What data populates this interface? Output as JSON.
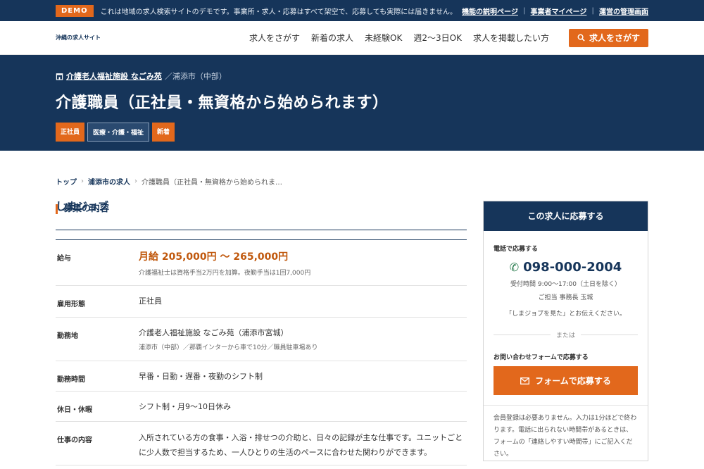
{
  "topbar": {
    "badge": "DEMO",
    "notice": "これは地域の求人検索サイトのデモです。事業所・求人・応募はすべて架空で、応募しても実際には届きません。",
    "links": [
      "機能の説明ページ",
      "事業者マイページ",
      "運営の管理画面"
    ]
  },
  "header": {
    "logo_sub": "沖縄の求人サイト",
    "logo_main": "しまジョブ",
    "nav": [
      "求人をさがす",
      "新着の求人",
      "未経験OK",
      "週2〜3日OK",
      "求人を掲載したい方"
    ],
    "search_button": "求人をさがす"
  },
  "hero": {
    "facility": "介護老人福祉施設 なごみ苑",
    "location": "／浦添市（中部）",
    "title": "介護職員（正社員・無資格から始められます）",
    "tags": [
      "正社員",
      "医療・介護・福祉",
      "新着"
    ]
  },
  "breadcrumb": [
    "トップ",
    "浦添市の求人",
    "介護職員（正社員・無資格から始められま…"
  ],
  "main": {
    "section_title": "募集の内容",
    "rows": [
      {
        "label": "給与",
        "value": "月給 205,000円 〜 265,000円",
        "sub": "介護福祉士は資格手当2万円を加算。夜勤手当は1回7,000円"
      },
      {
        "label": "雇用形態",
        "value": "正社員"
      },
      {
        "label": "勤務地",
        "value": "介護老人福祉施設 なごみ苑（浦添市宮城）",
        "sub": "浦添市（中部）／那覇インターから車で10分／職員駐車場あり"
      },
      {
        "label": "勤務時間",
        "value": "早番・日勤・遅番・夜勤のシフト制"
      },
      {
        "label": "休日・休暇",
        "value": "シフト制・月9〜10日休み"
      },
      {
        "label": "仕事の内容",
        "value": "入所されている方の食事・入浴・排せつの介助と、日々の記録が主な仕事です。ユニットごとに少人数で担当するため、一人ひとりの生活のペースに合わせた関わりができます。"
      }
    ]
  },
  "sidebar": {
    "title": "この求人に応募する",
    "phone_label": "電話で応募する",
    "phone": "098-000-2004",
    "hours": "受付時間 9:00〜17:00（土日を除く）",
    "contact": "ご担当 事務長 玉城",
    "tell": "「しまジョブを見た」とお伝えください。",
    "or": "または",
    "form_label": "お問い合わせフォームで応募する",
    "form_button": "フォームで応募する",
    "note": "会員登録は必要ありません。入力は1分ほどで終わります。電話に出られない時間帯があるときは、フォームの「連絡しやすい時間帯」にご記入ください。"
  },
  "colors": {
    "navy": "#16355a",
    "orange": "#e2681c"
  }
}
